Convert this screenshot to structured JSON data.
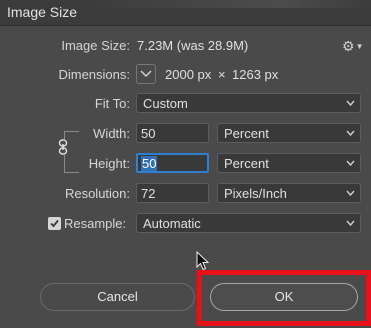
{
  "window": {
    "title": "Image Size"
  },
  "image_size": {
    "label": "Image Size:",
    "value": "7.23M (was 28.9M)"
  },
  "dimensions": {
    "label": "Dimensions:",
    "width": "2000 px",
    "separator": "×",
    "height": "1263 px"
  },
  "fit_to": {
    "label": "Fit To:",
    "selected": "Custom"
  },
  "width": {
    "label": "Width:",
    "value": "50",
    "unit": "Percent"
  },
  "height": {
    "label": "Height:",
    "value": "50",
    "unit": "Percent"
  },
  "resolution": {
    "label": "Resolution:",
    "value": "72",
    "unit": "Pixels/Inch"
  },
  "resample": {
    "label": "Resample:",
    "checked": true,
    "selected": "Automatic"
  },
  "buttons": {
    "cancel": "Cancel",
    "ok": "OK"
  },
  "icons": {
    "settings": "gear-icon",
    "dimensions_menu": "chevron-down-icon",
    "constrain": "link-icon",
    "cursor": "mouse-pointer-icon"
  },
  "colors": {
    "dialog_bg": "#4a4a4a",
    "focus_blue": "#2f7fd3",
    "highlight_red": "#e8111a"
  }
}
